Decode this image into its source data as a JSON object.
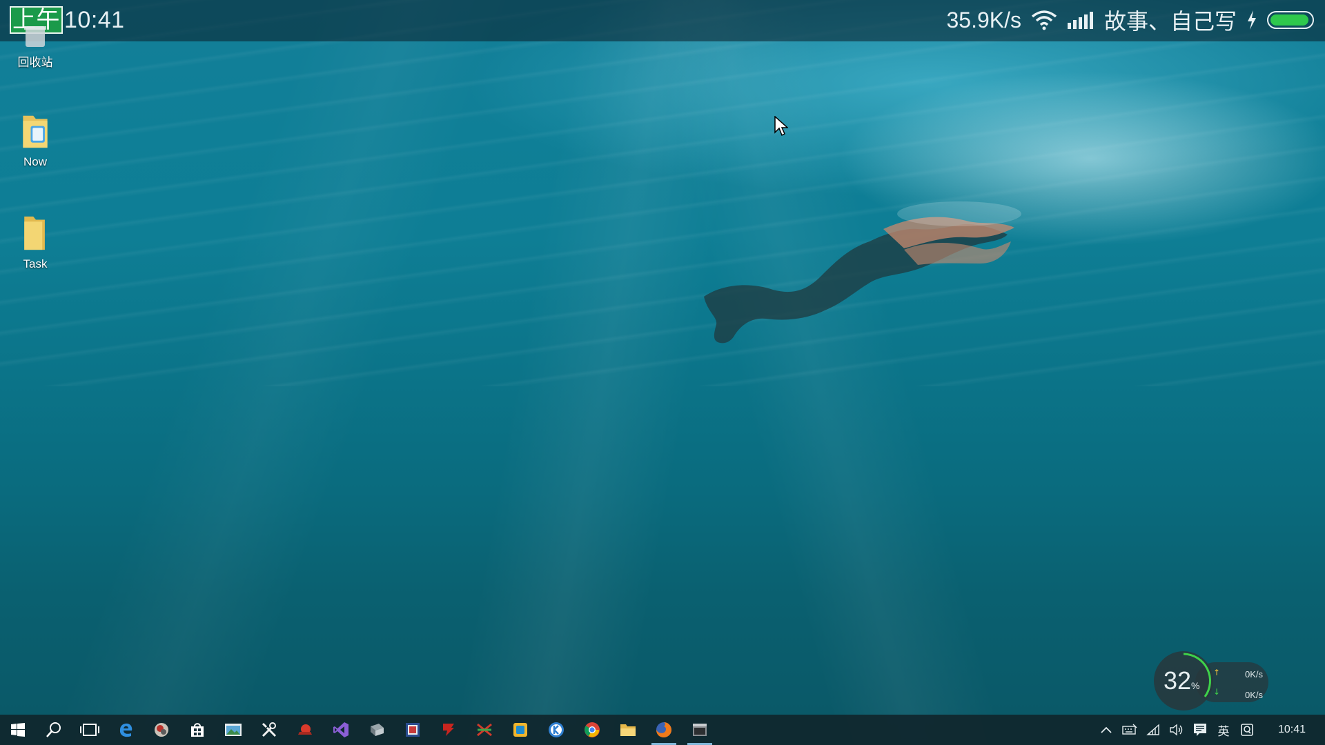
{
  "status_bar": {
    "ampm": "上午",
    "time": "10:41",
    "speed": "35.9K/s",
    "carrier": "故事、自己写",
    "icons": [
      "wifi-icon",
      "signal-icon",
      "charging-icon",
      "battery-icon"
    ],
    "battery_level": 0.95
  },
  "desktop": {
    "icons": [
      {
        "label": "回收站",
        "icon": "recycle-bin-icon"
      },
      {
        "label": "Now",
        "icon": "folder-icon"
      },
      {
        "label": "Task",
        "icon": "folder-icon"
      }
    ]
  },
  "net_widget": {
    "percent": "32",
    "percent_sign": "%",
    "upload": "0K/s",
    "download": "0K/s"
  },
  "taskbar": {
    "apps": [
      "start-icon",
      "search-icon",
      "task-view-icon",
      "edge-icon",
      "image-viewer-icon",
      "store-icon",
      "photos-icon",
      "tools-icon",
      "snail-icon",
      "visual-studio-icon",
      "book-icon",
      "media-icon",
      "filezilla-icon",
      "scissors-icon",
      "app-square-icon",
      "k-circle-icon",
      "chrome-icon",
      "file-explorer-icon",
      "firefox-icon",
      "terminal-window-icon"
    ],
    "tray": {
      "lang": "英",
      "time": "10:41",
      "icons": [
        "chevron-up-icon",
        "keyboard-icon",
        "network-icon",
        "volume-icon",
        "notification-icon",
        "input-method-icon"
      ]
    }
  },
  "colors": {
    "battery": "#2ec84c",
    "ampm_bg": "#1b9a4a",
    "water_top": "#137f99",
    "water_bottom": "#0a5766"
  }
}
